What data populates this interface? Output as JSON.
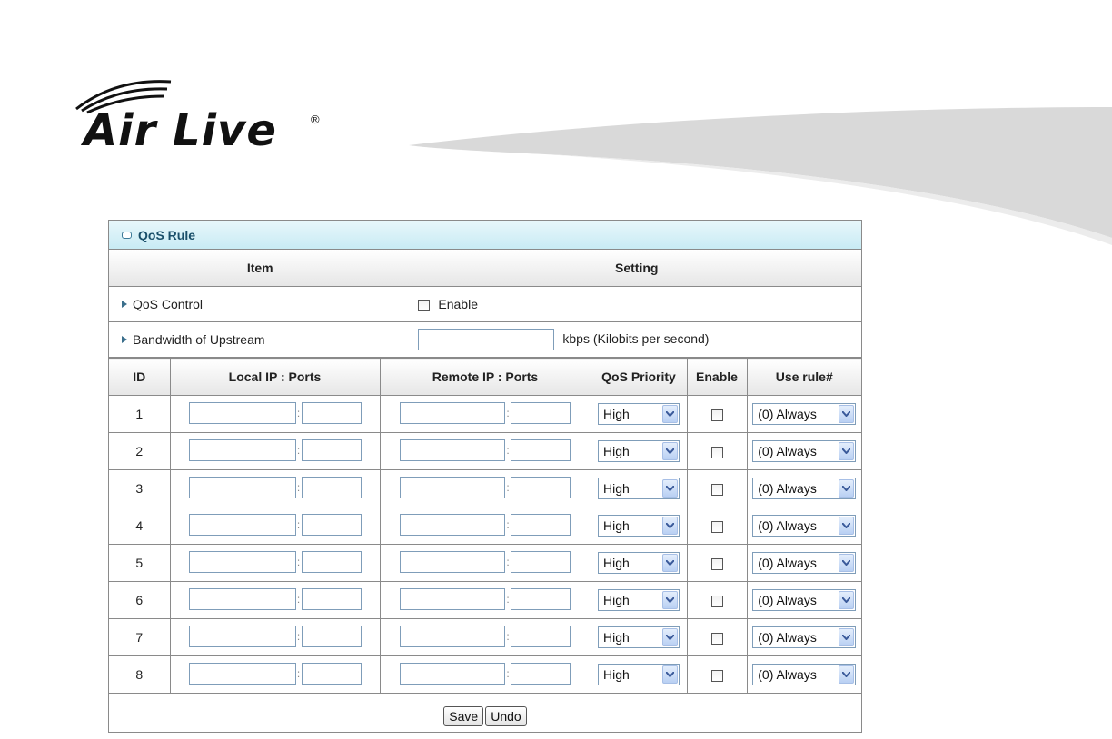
{
  "brand": {
    "name": "Air Live",
    "registered": "®"
  },
  "panel": {
    "title": "QoS Rule",
    "columns": {
      "item": "Item",
      "setting": "Setting"
    },
    "qos_control": {
      "label": "QoS Control",
      "checkbox_label": "Enable",
      "checked": false
    },
    "bandwidth": {
      "label": "Bandwidth of Upstream",
      "value": "",
      "unit": "kbps (Kilobits per second)"
    }
  },
  "rules": {
    "headers": {
      "id": "ID",
      "local": "Local IP : Ports",
      "remote": "Remote IP : Ports",
      "priority": "QoS Priority",
      "enable": "Enable",
      "use_rule": "Use rule#"
    },
    "separator": ":",
    "rows": [
      {
        "id": "1",
        "priority": "High",
        "use_rule": "(0) Always"
      },
      {
        "id": "2",
        "priority": "High",
        "use_rule": "(0) Always"
      },
      {
        "id": "3",
        "priority": "High",
        "use_rule": "(0) Always"
      },
      {
        "id": "4",
        "priority": "High",
        "use_rule": "(0) Always"
      },
      {
        "id": "5",
        "priority": "High",
        "use_rule": "(0) Always"
      },
      {
        "id": "6",
        "priority": "High",
        "use_rule": "(0) Always"
      },
      {
        "id": "7",
        "priority": "High",
        "use_rule": "(0) Always"
      },
      {
        "id": "8",
        "priority": "High",
        "use_rule": "(0) Always"
      }
    ]
  },
  "buttons": {
    "save": "Save",
    "undo": "Undo"
  },
  "colors": {
    "title_bar": "#c8ebf4",
    "border": "#8a8a8a",
    "swoosh": "#d9d9d9"
  }
}
